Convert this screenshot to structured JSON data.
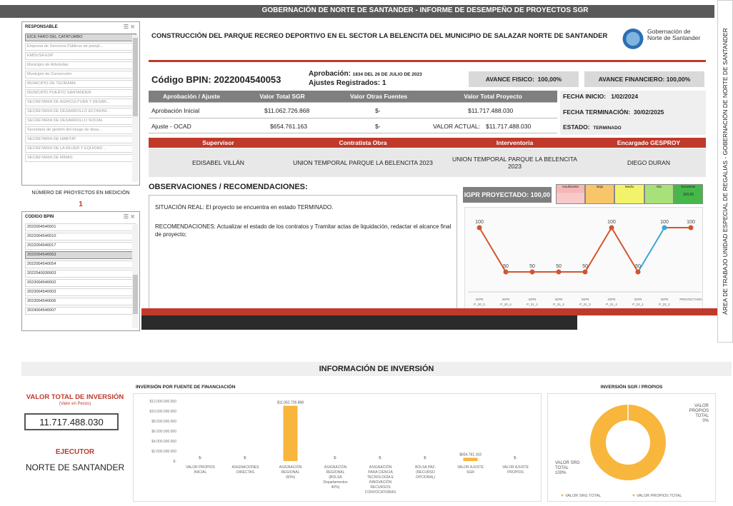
{
  "header": {
    "title": "GOBERNACIÓN DE NORTE DE SANTANDER - INFORME DE DESEMPEÑO DE PROYECTOS SGR"
  },
  "side_tab": {
    "label": "ÁREA DE TRABAJO UNIDAD ESPECIAL DE REGALIAS - GOBERNACIÓN DE NORTE DE SANTANDER"
  },
  "responsable": {
    "title": "RESPONSABLE",
    "items": [
      "EICE FARO DEL CATATUMBO",
      "Empresa de Servicios Públicos de pampl...",
      "EMDUSA ESP",
      "Municipio de Arboledas",
      "Municipio de Convención",
      "MUNICIPIO DE TEORAMA",
      "MUNICIPIO PUERTO SANTANDER",
      "SECRETARIA DE AGRICULTURA Y DESAR...",
      "SECRETARIA DE DESARROLLO ECONOM...",
      "SECRETARIA DE DESARROLLO SOCIAL",
      "Secretaria de gestión del riesgo de desa...",
      "SECRETARIA DE HABITAT",
      "SECRETARIA DE LA MUJER Y EQUIDAD ...",
      "SECRETARIA DE MINAS"
    ]
  },
  "num_proyectos": {
    "label": "NÚMERO DE PROYECTOS EN MEDICIÓN",
    "value": "1"
  },
  "codigo": {
    "title": "CODIGO BPIN",
    "items": [
      "2022004540001",
      "2022004540010",
      "2022004540017",
      "2022004540053",
      "2022004540054",
      "2022540030003",
      "2023004540002",
      "2023004540003",
      "2023004540006",
      "2024004540007"
    ]
  },
  "project": {
    "title": "CONSTRUCCIÓN DEL PARQUE RECREO DEPORTIVO EN EL SECTOR LA BELENCITA DEL MUNICIPIO DE  SALAZAR NORTE DE SANTANDER",
    "logo_text": "Gobernación de Norte de Santander"
  },
  "bpin": {
    "label": "Código BPIN:",
    "value": "2022004540053",
    "aprob_label": "Aprobación:",
    "aprob_value": "1834 DEL 26 DE JULIO DE 2023",
    "ajustes_label": "Ajustes Registrados:",
    "ajustes_value": "1"
  },
  "avance": {
    "fisico_label": "AVANCE FISICO:",
    "fisico_value": "100,00%",
    "fin_label": "AVANCE FINANCIERO:",
    "fin_value": "100,00%"
  },
  "table": {
    "headers": [
      "Aprobación / Ajuste",
      "Valor Total SGR",
      "Valor Otras Fuentes",
      "Valor Total Proyecto"
    ],
    "row1": [
      "Aprobación Inicial",
      "$11.062.726.868",
      "$-",
      "$11.717.488.030"
    ],
    "row2": [
      "Ajuste - OCAD",
      "$654.761.163",
      "$-",
      "VALOR ACTUAL:",
      "$11.717.488.030"
    ]
  },
  "fechas": {
    "inicio_label": "FECHA INICIO:",
    "inicio_value": "1/02/2024",
    "term_label": "FECHA TERMINACIÓN:",
    "term_value": "30/02/2025",
    "estado_label": "ESTADO:",
    "estado_value": "TERMINADO"
  },
  "actors": {
    "headers": [
      "Supervisor",
      "Contratista Obra",
      "Interventoria",
      "Encargado GESPROY"
    ],
    "values": [
      "EDISABEL VILLÁN",
      "UNION TEMPORAL PARQUE LA BELENCITA 2023",
      "UNION TEMPORAL PARQUE LA BELENCITA 2023",
      "DIEGO DURAN"
    ]
  },
  "obs": {
    "title": "OBSERVACIONES / RECOMENDACIONES:",
    "situacion": "SITUACIÓN REAL: El proyecto se encuentra en estado TERMINADO.",
    "recomendaciones": "RECOMENDACIONES: Actualizar el estado de los contratos y Tramitar actas de liquidación, redactar el alcance final de proyecto;"
  },
  "igpr": {
    "label": "IGPR PROYECTADO:",
    "value": "100,00",
    "scale": [
      {
        "label": "Insuficiente",
        "color": "#f4b6b6"
      },
      {
        "label": "Bajo",
        "color": "#f9c56a"
      },
      {
        "label": "Medio",
        "color": "#f3f36b"
      },
      {
        "label": "Alto",
        "color": "#a8e07a"
      },
      {
        "label": "Excelente",
        "color": "#46b84a"
      }
    ],
    "scale_value": "100,00"
  },
  "chart_data": [
    {
      "type": "line",
      "categories": [
        "IGPR P_20_3",
        "IGPR P_20_4",
        "IGPR P_21_1",
        "IGPR P_21_2",
        "IGPR P_21_3",
        "IGPR P_21_4",
        "IGPR P_22_1",
        "IGPR P_22_2",
        "PROYECTADO"
      ],
      "values": [
        100,
        50,
        50,
        50,
        50,
        100,
        50,
        100,
        100
      ],
      "labels": [
        "100",
        "50",
        "50",
        "50",
        "50",
        "100",
        "50",
        "100",
        "100"
      ],
      "colors": {
        "main": "#d2552f",
        "projected": "#3aa6d8"
      }
    },
    {
      "type": "bar",
      "title": "INVERSIÓN POR FUENTE DE FINANCIACIÓN",
      "categories": [
        "VALOR PROPIOS INICIAL",
        "ASIGNACIONES DIRECTAS",
        "ASIGNACIÓN REGIONAL (60%)",
        "ASIGNACIÓN REGIONAL (BOLSA Departamentos 40%)",
        "ASIGNACIÓN PARA CIENCIA TECNOLOGÍA E INNOVACIÓN RECURSOS CONVOCATORIAS",
        "BOLSA PAZ- (RECURSO OPCIONAL)",
        "VALOR AJUSTE SGR",
        "VALOR AJUSTE PROPIOS"
      ],
      "values": [
        0,
        0,
        11062726868,
        0,
        0,
        0,
        654761163,
        0
      ],
      "labels": [
        "$-",
        "$-",
        "$11.062.726.868",
        "$-",
        "$-",
        "$-",
        "$654.761.163",
        "$-"
      ],
      "yticks": [
        "$12.000.000.000",
        "$10.000.000.000",
        "$8.000.000.000",
        "$6.000.000.000",
        "$4.000.000.000",
        "$2.000.000.000",
        "$-"
      ],
      "ylim": [
        0,
        12000000000
      ],
      "color": "#f8b63d"
    },
    {
      "type": "pie",
      "title": "INVERSIÓN SGR / PROPIOS",
      "slices": [
        {
          "name": "VALOR SRG TOTAL",
          "value": 100,
          "label": "VALOR SRG TOTAL 100%"
        },
        {
          "name": "VALOR PROPIOS TOTAL",
          "value": 0,
          "label": "VALOR PROPIOS TOTAL 0%"
        }
      ],
      "legend": [
        "VALOR SRG TOTAL",
        "VALOR PROPIOS TOTAL"
      ],
      "color": "#f8b63d"
    }
  ],
  "inversion": {
    "section_title": "INFORMACIÓN DE INVERSIÓN",
    "total_label": "VALOR TOTAL DE INVERSIÓN",
    "total_sub": "(Valor en Pesos)",
    "total_value": "11.717.488.030",
    "ejecutor_label": "EJECUTOR",
    "ejecutor_value": "NORTE DE SANTANDER"
  }
}
